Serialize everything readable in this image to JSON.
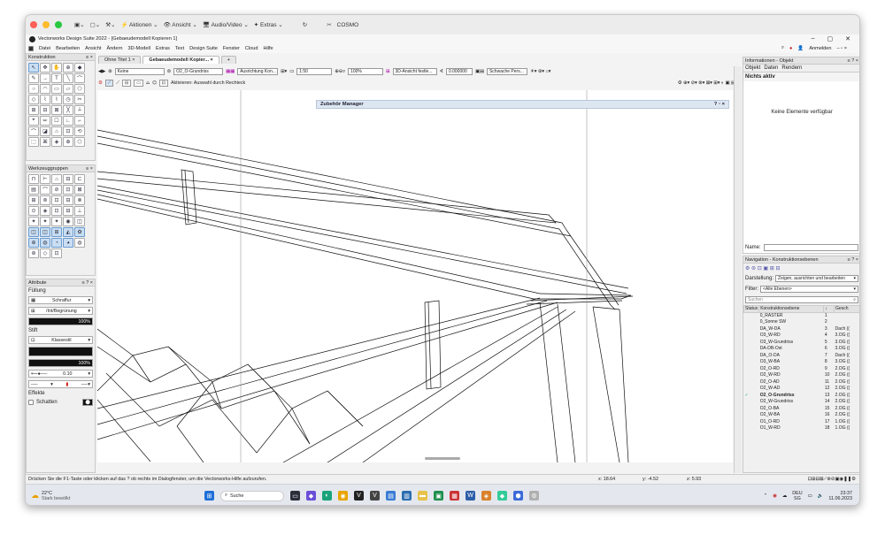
{
  "mac_bar": {
    "aktionen": "Aktionen",
    "ansicht": "Ansicht",
    "audio_video": "Audio/Video",
    "extras": "Extras",
    "app": "COSMO"
  },
  "window": {
    "title": "Vectorworks Design Suite 2022 - [Gebaeudemodell Kopieren 1]"
  },
  "menu": [
    "Datei",
    "Bearbeiten",
    "Ansicht",
    "Ändern",
    "3D-Modell",
    "Extras",
    "Text",
    "Design Suite",
    "Fenster",
    "Cloud",
    "Hilfe"
  ],
  "top_right": {
    "anmelden": "Anmelden"
  },
  "tabs": [
    "Ohne Titel 1",
    "Gebaeudemodell Kopier..."
  ],
  "toolbar1": {
    "klasse": "Keine",
    "ebene": "O2_O-Grundriss",
    "ausrichtung": "Ausrichtung Kon...",
    "scale": "1:50",
    "zoom": "100%",
    "ansicht3d": "3D-Ansicht festle...",
    "value": "0.000000",
    "render": "Schwache Pers..."
  },
  "toolbar2": {
    "mode_text": "Aktivieren: Auswahl durch Rechteck"
  },
  "konstruktion": {
    "title": "Konstruktion",
    "tools": [
      "↖",
      "✥",
      "✋",
      "⊕",
      "◆",
      "✎",
      "→",
      "T",
      "╲",
      "⌒",
      "○",
      "◠",
      "▭",
      "▱",
      "⬠",
      "◇",
      "⌇",
      "⌇",
      "◷",
      "✂",
      "⊞",
      "⊟",
      "⊠",
      "╳",
      "⟂",
      "⌖",
      "✏",
      "☐",
      "∟",
      "⌐",
      "⌒",
      "◪",
      "⌂",
      "⊡",
      "⟲",
      "⬚",
      "⌘",
      "◈",
      "⊕",
      "⬡"
    ]
  },
  "werkzeuggruppen": {
    "title": "Werkzeuggruppen",
    "tools": [
      "⊓",
      "⊢",
      "⌂",
      "⊟",
      "⊏",
      "▤",
      "⌒",
      "⊘",
      "⊡",
      "⊠",
      "⊞",
      "⊚",
      "⊡",
      "⊟",
      "⊗",
      "⊙",
      "◈",
      "⊡",
      "⊟",
      "⊥",
      "✦",
      "✦",
      "✦",
      "◉",
      "◫",
      "◫",
      "◫",
      "⊞",
      "◭",
      "✿",
      "⊕",
      "◍",
      "◔",
      "◕",
      "◍",
      "⊛",
      "◇",
      "⊡"
    ]
  },
  "attribute": {
    "title": "Attribute",
    "fuellung": "Füllung",
    "schraffur": "Schraffur",
    "begruendung": "/Int/Begrünung",
    "opacity1": "100%",
    "stift": "Stift",
    "klassestil": "Klassestil",
    "opacity2": "100%",
    "lw": "0.10",
    "effekte": "Effekte",
    "schatten": "Schatten"
  },
  "canvas": {
    "manager_title": "Zubehör Manager",
    "manager_ctrl": "? ▫ ×"
  },
  "info": {
    "title": "Informationen - Objekt",
    "tabs": [
      "Objekt",
      "Daten",
      "Rendern"
    ],
    "status": "Nichts aktiv",
    "empty": "Keine Elemente verfügbar",
    "name_label": "Name:"
  },
  "nav": {
    "title": "Navigation - Konstruktionsebenen",
    "darstellung_label": "Darstellung:",
    "darstellung": "Zeigen, ausrichten und bearbeiten",
    "filter_label": "Filter:",
    "filter": "<Alle Ebenen>",
    "search": "Suchen",
    "headers": [
      "Status",
      "Konstruktionsebene",
      "↓",
      "Gesch"
    ],
    "rows": [
      {
        "status": "",
        "name": "0_RASTER",
        "num": "1",
        "g": ""
      },
      {
        "status": "",
        "name": "0_Sonne SW",
        "num": "2",
        "g": ""
      },
      {
        "status": "",
        "name": "DA_W-DA",
        "num": "3",
        "g": "Dach (("
      },
      {
        "status": "",
        "name": "O3_W-RD",
        "num": "4",
        "g": "3.OG (("
      },
      {
        "status": "",
        "name": "O3_W-Grundriss",
        "num": "5",
        "g": "3.OG (("
      },
      {
        "status": "",
        "name": "DA-DB-Ost",
        "num": "6",
        "g": "3.OG (("
      },
      {
        "status": "",
        "name": "DA_O-DA",
        "num": "7",
        "g": "Dach (("
      },
      {
        "status": "",
        "name": "O3_W-BA",
        "num": "8",
        "g": "3.OG (("
      },
      {
        "status": "",
        "name": "O2_O-RD",
        "num": "9",
        "g": "2.OG (("
      },
      {
        "status": "",
        "name": "O2_W-RD",
        "num": "10",
        "g": "2.OG (("
      },
      {
        "status": "",
        "name": "O2_O-AD",
        "num": "11",
        "g": "2.OG (("
      },
      {
        "status": "",
        "name": "O2_W-AD",
        "num": "12",
        "g": "2.OG (("
      },
      {
        "status": "✓",
        "name": "O2_O-Grundriss",
        "num": "13",
        "g": "2.OG (("
      },
      {
        "status": "",
        "name": "O2_W-Grundriss",
        "num": "14",
        "g": "2.OG (("
      },
      {
        "status": "",
        "name": "O2_O-BA",
        "num": "15",
        "g": "2.OG (("
      },
      {
        "status": "",
        "name": "O2_W-BA",
        "num": "16",
        "g": "2.OG (("
      },
      {
        "status": "",
        "name": "O1_O-RD",
        "num": "17",
        "g": "1.OG (("
      },
      {
        "status": "",
        "name": "O1_W-RD",
        "num": "18",
        "g": "1.OG (("
      }
    ]
  },
  "status_bar": {
    "hint": "Drücken Sie die F1-Taste oder klicken auf das ? ob rechts im Dialogfenster, um die Vectorworks-Hilfe aufzurufen.",
    "x": "x: 18.64",
    "y": "y: -4.52",
    "z": "z: 5.93"
  },
  "taskbar": {
    "temp": "22°C",
    "weather": "Stark bewölkt",
    "search": "Suche",
    "lang": "DEU",
    "region": "SG",
    "time": "23:37",
    "date": "11.06.2023"
  }
}
